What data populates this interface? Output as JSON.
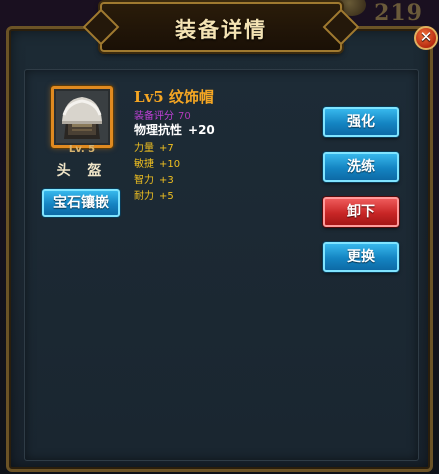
{
  "background": {
    "stat_text": "219"
  },
  "window": {
    "title": "装备详情",
    "close_glyph": "✕"
  },
  "equipment_slot": {
    "icon": "helmet-icon",
    "level": "Lv. 5",
    "label": "头 盔",
    "gem_button": "宝石镶嵌"
  },
  "item": {
    "name": "Lv5 纹饰帽",
    "score_label": "装备评分",
    "score_value": "70",
    "main_attr_label": "物理抗性",
    "main_attr_value": "+20",
    "stats": [
      {
        "label": "力量",
        "value": "+7"
      },
      {
        "label": "敏捷",
        "value": "+10"
      },
      {
        "label": "智力",
        "value": "+3"
      },
      {
        "label": "耐力",
        "value": "+5"
      }
    ]
  },
  "actions": {
    "enhance": "强化",
    "refine": "洗练",
    "unequip": "卸下",
    "replace": "更换"
  },
  "colors": {
    "frame_gold": "#a07a30",
    "item_name": "#f5a623",
    "score": "#c040d8",
    "stat": "#f0c020",
    "button_blue": "#1484c2",
    "button_red": "#c82626"
  }
}
